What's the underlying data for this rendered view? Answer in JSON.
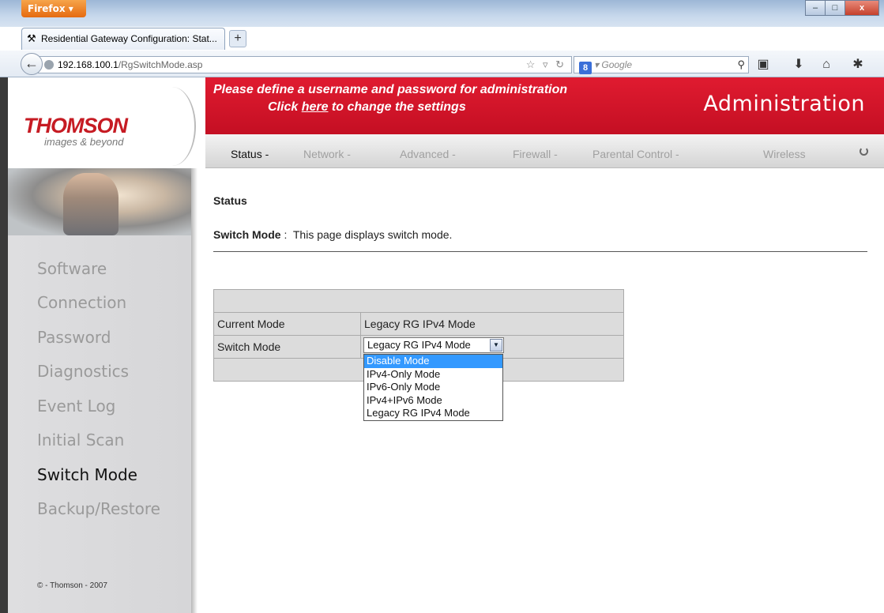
{
  "browser": {
    "menu_button": "Firefox ▾",
    "tab_title": "Residential Gateway Configuration: Stat...",
    "new_tab": "+",
    "url_host": "192.168.100.1",
    "url_path": "/RgSwitchMode.asp",
    "search_placeholder": "Google",
    "window_controls": {
      "minimize": "–",
      "maximize": "□",
      "close": "x"
    }
  },
  "logo": {
    "brand": "THOMSON",
    "tagline": "images & beyond"
  },
  "banner": {
    "line1": "Please define a username and password for administration",
    "line2_prefix": "Click ",
    "line2_link": "here",
    "line2_suffix": " to change the settings",
    "section_title": "Administration"
  },
  "topnav": {
    "items": [
      "Status -",
      "Network -",
      "Advanced -",
      "Firewall -",
      "Parental Control -",
      "Wireless"
    ],
    "active_index": 0
  },
  "sidebar": {
    "items": [
      "Software",
      "Connection",
      "Password",
      "Diagnostics",
      "Event Log",
      "Initial Scan",
      "Switch Mode",
      "Backup/Restore"
    ],
    "active_index": 6,
    "copyright": "© - Thomson - 2007"
  },
  "main": {
    "heading": "Status",
    "desc_label": "Switch Mode",
    "desc_sep": " :  ",
    "desc_text": "This page displays switch mode.",
    "table": {
      "current_mode_label": "Current Mode",
      "current_mode_value": "Legacy RG IPv4 Mode",
      "switch_mode_label": "Switch Mode"
    },
    "select": {
      "value": "Legacy RG IPv4 Mode",
      "options": [
        "Disable Mode",
        "IPv4-Only Mode",
        "IPv6-Only Mode",
        "IPv4+IPv6 Mode",
        "Legacy RG IPv4 Mode"
      ],
      "highlighted_index": 0
    }
  },
  "colors": {
    "banner_red": "#d3182b",
    "brand_red": "#c61b23",
    "highlight_blue": "#3399ff"
  }
}
